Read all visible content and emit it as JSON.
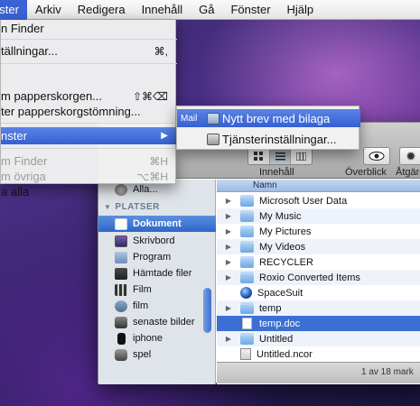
{
  "menubar": {
    "items": [
      "nster",
      "Arkiv",
      "Redigera",
      "Innehåll",
      "Gå",
      "Fönster",
      "Hjälp"
    ]
  },
  "arkiv_menu": {
    "items": [
      {
        "label": "n Finder",
        "shortcut": "",
        "disabled": false
      },
      {
        "label": "tällningar...",
        "shortcut": "⌘,",
        "disabled": false
      },
      {
        "label": "m papperskorgen...",
        "shortcut": "⇧⌘⌫",
        "disabled": false
      },
      {
        "label": "ter papperskorgstömning...",
        "shortcut": "",
        "disabled": false
      },
      {
        "label": "nster",
        "shortcut": "",
        "disabled": false,
        "highlighted": true
      },
      {
        "label": "m Finder",
        "shortcut": "⌘H",
        "disabled": true
      },
      {
        "label": "m övriga",
        "shortcut": "⌥⌘H",
        "disabled": true
      },
      {
        "label": "a alla",
        "shortcut": "",
        "disabled": false
      }
    ]
  },
  "submenu": {
    "group_label": "Mail",
    "items": [
      {
        "label": "Nytt brev med bilaga"
      },
      {
        "label": "Tjänsterinställningar..."
      }
    ]
  },
  "finder": {
    "toolbar": {
      "view_label": "Innehåll",
      "quicklook_label": "Överblick",
      "action_label": "Åtgärd"
    },
    "sidebar": {
      "partial_item": "Alla...",
      "section_title": "PLATSER",
      "items": [
        {
          "label": "Dokument",
          "icon": "documents-icon",
          "selected": true
        },
        {
          "label": "Skrivbord",
          "icon": "desktop-icon"
        },
        {
          "label": "Program",
          "icon": "applications-icon"
        },
        {
          "label": "Hämtade filer",
          "icon": "downloads-icon"
        },
        {
          "label": "Film",
          "icon": "movies-icon"
        },
        {
          "label": "film",
          "icon": "folder-icon"
        },
        {
          "label": "senaste bilder",
          "icon": "smart-folder-icon"
        },
        {
          "label": "iphone",
          "icon": "iphone-icon"
        },
        {
          "label": "spel",
          "icon": "games-icon"
        }
      ]
    },
    "list": {
      "column_header": "Namn",
      "rows": [
        {
          "name": "Microsoft User Data",
          "type": "folder"
        },
        {
          "name": "My Music",
          "type": "folder"
        },
        {
          "name": "My Pictures",
          "type": "folder"
        },
        {
          "name": "My Videos",
          "type": "folder"
        },
        {
          "name": "RECYCLER",
          "type": "folder"
        },
        {
          "name": "Roxio Converted Items",
          "type": "folder"
        },
        {
          "name": "SpaceSuit",
          "type": "app"
        },
        {
          "name": "temp",
          "type": "folder"
        },
        {
          "name": "temp.doc",
          "type": "document",
          "selected": true
        },
        {
          "name": "Untitled",
          "type": "folder"
        },
        {
          "name": "Untitled.ncor",
          "type": "file"
        }
      ]
    },
    "status_text": "1 av 18 mark"
  }
}
